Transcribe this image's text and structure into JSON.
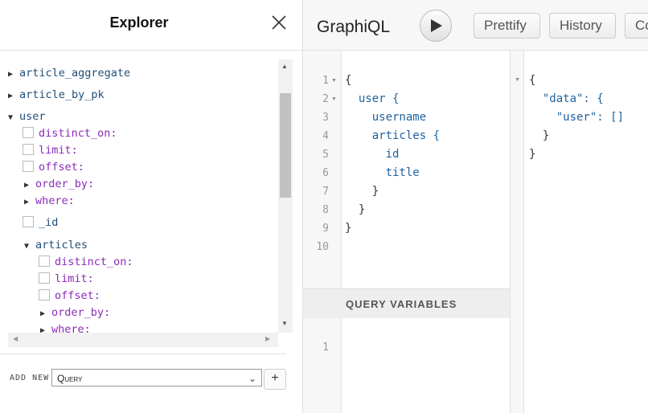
{
  "explorer": {
    "title": "Explorer",
    "tree": [
      {
        "label": "article_aggregate",
        "kind": "field",
        "state": "collapsed"
      },
      {
        "label": "article_by_pk",
        "kind": "field",
        "state": "collapsed"
      },
      {
        "label": "user",
        "kind": "field",
        "state": "expanded"
      },
      {
        "label": "distinct_on:",
        "kind": "arg-checkbox"
      },
      {
        "label": "limit:",
        "kind": "arg-checkbox"
      },
      {
        "label": "offset:",
        "kind": "arg-checkbox"
      },
      {
        "label": "order_by:",
        "kind": "arg-collapsed"
      },
      {
        "label": "where:",
        "kind": "arg-collapsed"
      },
      {
        "label": "_id",
        "kind": "field-checkbox"
      },
      {
        "label": "articles",
        "kind": "field",
        "state": "expanded"
      },
      {
        "label": "distinct_on:",
        "kind": "arg-checkbox"
      },
      {
        "label": "limit:",
        "kind": "arg-checkbox"
      },
      {
        "label": "offset:",
        "kind": "arg-checkbox"
      },
      {
        "label": "order_by:",
        "kind": "arg-collapsed"
      },
      {
        "label": "where:",
        "kind": "arg-collapsed"
      }
    ],
    "footer": {
      "add_label": "ADD  NEW",
      "operation_select": "Query",
      "add_button": "+"
    }
  },
  "toolbar": {
    "title": "GraphiQL",
    "prettify": "Prettify",
    "history": "History",
    "copy": "Co"
  },
  "query": {
    "line_numbers": [
      "1",
      "2",
      "3",
      "4",
      "5",
      "6",
      "7",
      "8",
      "9",
      "10"
    ],
    "lines": [
      "{",
      "  user {",
      "    username",
      "    articles {",
      "      id",
      "      title",
      "    }",
      "  }",
      "}",
      ""
    ]
  },
  "variables": {
    "label": "QUERY VARIABLES",
    "line_numbers": [
      "1"
    ]
  },
  "result": {
    "lines": [
      "{",
      "  \"data\": {",
      "    \"user\": []",
      "  }",
      "}"
    ]
  },
  "colors": {
    "field": "#1f4e79",
    "argument": "#8b2bb9",
    "string": "#c41a16",
    "toolbar_bg": "#f7f7f7"
  }
}
